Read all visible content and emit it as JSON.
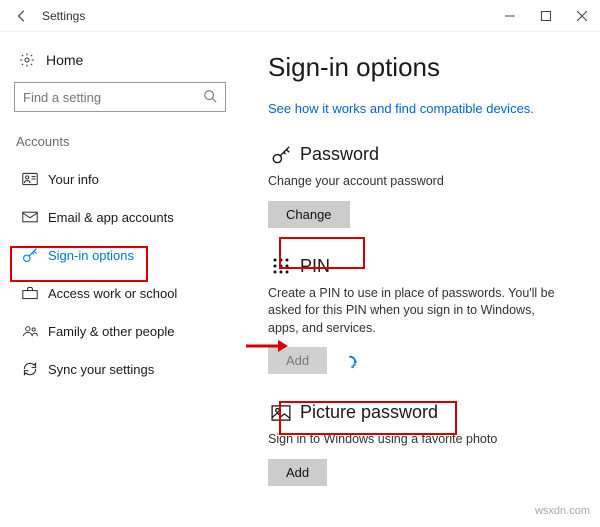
{
  "window": {
    "title": "Settings"
  },
  "sidebar": {
    "home_label": "Home",
    "search_placeholder": "Find a setting",
    "group_label": "Accounts",
    "items": [
      {
        "label": "Your info",
        "icon": "person-card-icon"
      },
      {
        "label": "Email & app accounts",
        "icon": "mail-icon"
      },
      {
        "label": "Sign-in options",
        "icon": "key-icon",
        "selected": true
      },
      {
        "label": "Access work or school",
        "icon": "briefcase-icon"
      },
      {
        "label": "Family & other people",
        "icon": "people-icon"
      },
      {
        "label": "Sync your settings",
        "icon": "sync-icon"
      }
    ]
  },
  "main": {
    "title": "Sign-in options",
    "help_link": "See how it works and find compatible devices.",
    "password": {
      "heading": "Password",
      "desc": "Change your account password",
      "button": "Change"
    },
    "pin": {
      "heading": "PIN",
      "desc": "Create a PIN to use in place of passwords. You'll be asked for this PIN when you sign in to Windows, apps, and services.",
      "button": "Add"
    },
    "picture": {
      "heading": "Picture password",
      "desc": "Sign in to Windows using a favorite photo",
      "button": "Add"
    }
  },
  "watermark": "wsxdn.com"
}
